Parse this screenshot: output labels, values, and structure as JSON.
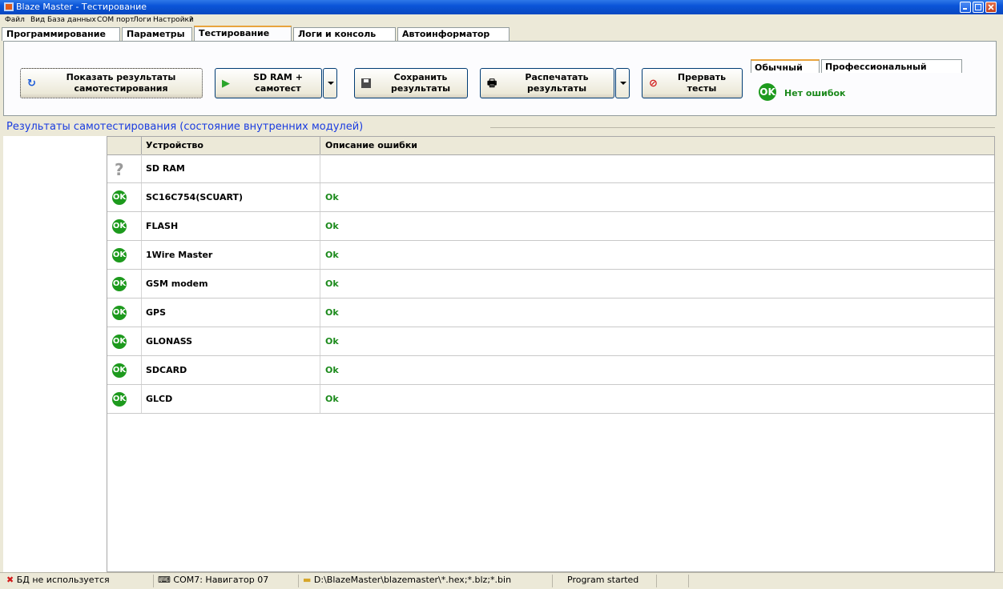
{
  "window": {
    "title": "Blaze Master - Тестирование"
  },
  "menu": [
    "Файл",
    "Вид",
    "База данных",
    "COM порт",
    "Логи",
    "Настройки",
    "?"
  ],
  "tabs": [
    "Программирование",
    "Параметры",
    "Тестирование",
    "Логи и консоль",
    "Автоинформатор"
  ],
  "active_tab": "Тестирование",
  "toolbar": {
    "show_results": "Показать результаты самотестирования",
    "sdram_selftest": "SD RAM + самотест",
    "save_results": "Сохранить результаты",
    "print_results": "Распечатать результаты",
    "abort_tests": "Прервать тесты"
  },
  "mode": {
    "tabs": [
      "Обычный",
      "Профессиональный"
    ],
    "active": "Обычный",
    "status_badge": "OK",
    "status_text": "Нет ошибок"
  },
  "section_title": "Результаты самотестирования (состояние внутренних модулей)",
  "grid": {
    "columns": [
      "Устройство",
      "Описание ошибки"
    ],
    "rows": [
      {
        "device": "SD RAM",
        "status": "unknown",
        "desc": ""
      },
      {
        "device": "SC16C754(SCUART)",
        "status": "OK",
        "desc": "Ok"
      },
      {
        "device": "FLASH",
        "status": "OK",
        "desc": "Ok"
      },
      {
        "device": "1Wire Master",
        "status": "OK",
        "desc": "Ok"
      },
      {
        "device": "GSM modem",
        "status": "OK",
        "desc": "Ok"
      },
      {
        "device": "GPS",
        "status": "OK",
        "desc": "Ok"
      },
      {
        "device": "GLONASS",
        "status": "OK",
        "desc": "Ok"
      },
      {
        "device": "SDCARD",
        "status": "OK",
        "desc": "Ok"
      },
      {
        "device": "GLCD",
        "status": "OK",
        "desc": "Ok"
      }
    ]
  },
  "statusbar": {
    "db": "БД не используется",
    "com": "COM7: Навигатор 07",
    "path": "D:\\BlazeMaster\\blazemaster\\*.hex;*.blz;*.bin",
    "program": "Program started"
  },
  "colors": {
    "ok_green": "#1d9a1d",
    "section_blue": "#1a3ce0",
    "titlebar": "#0a55d8"
  }
}
